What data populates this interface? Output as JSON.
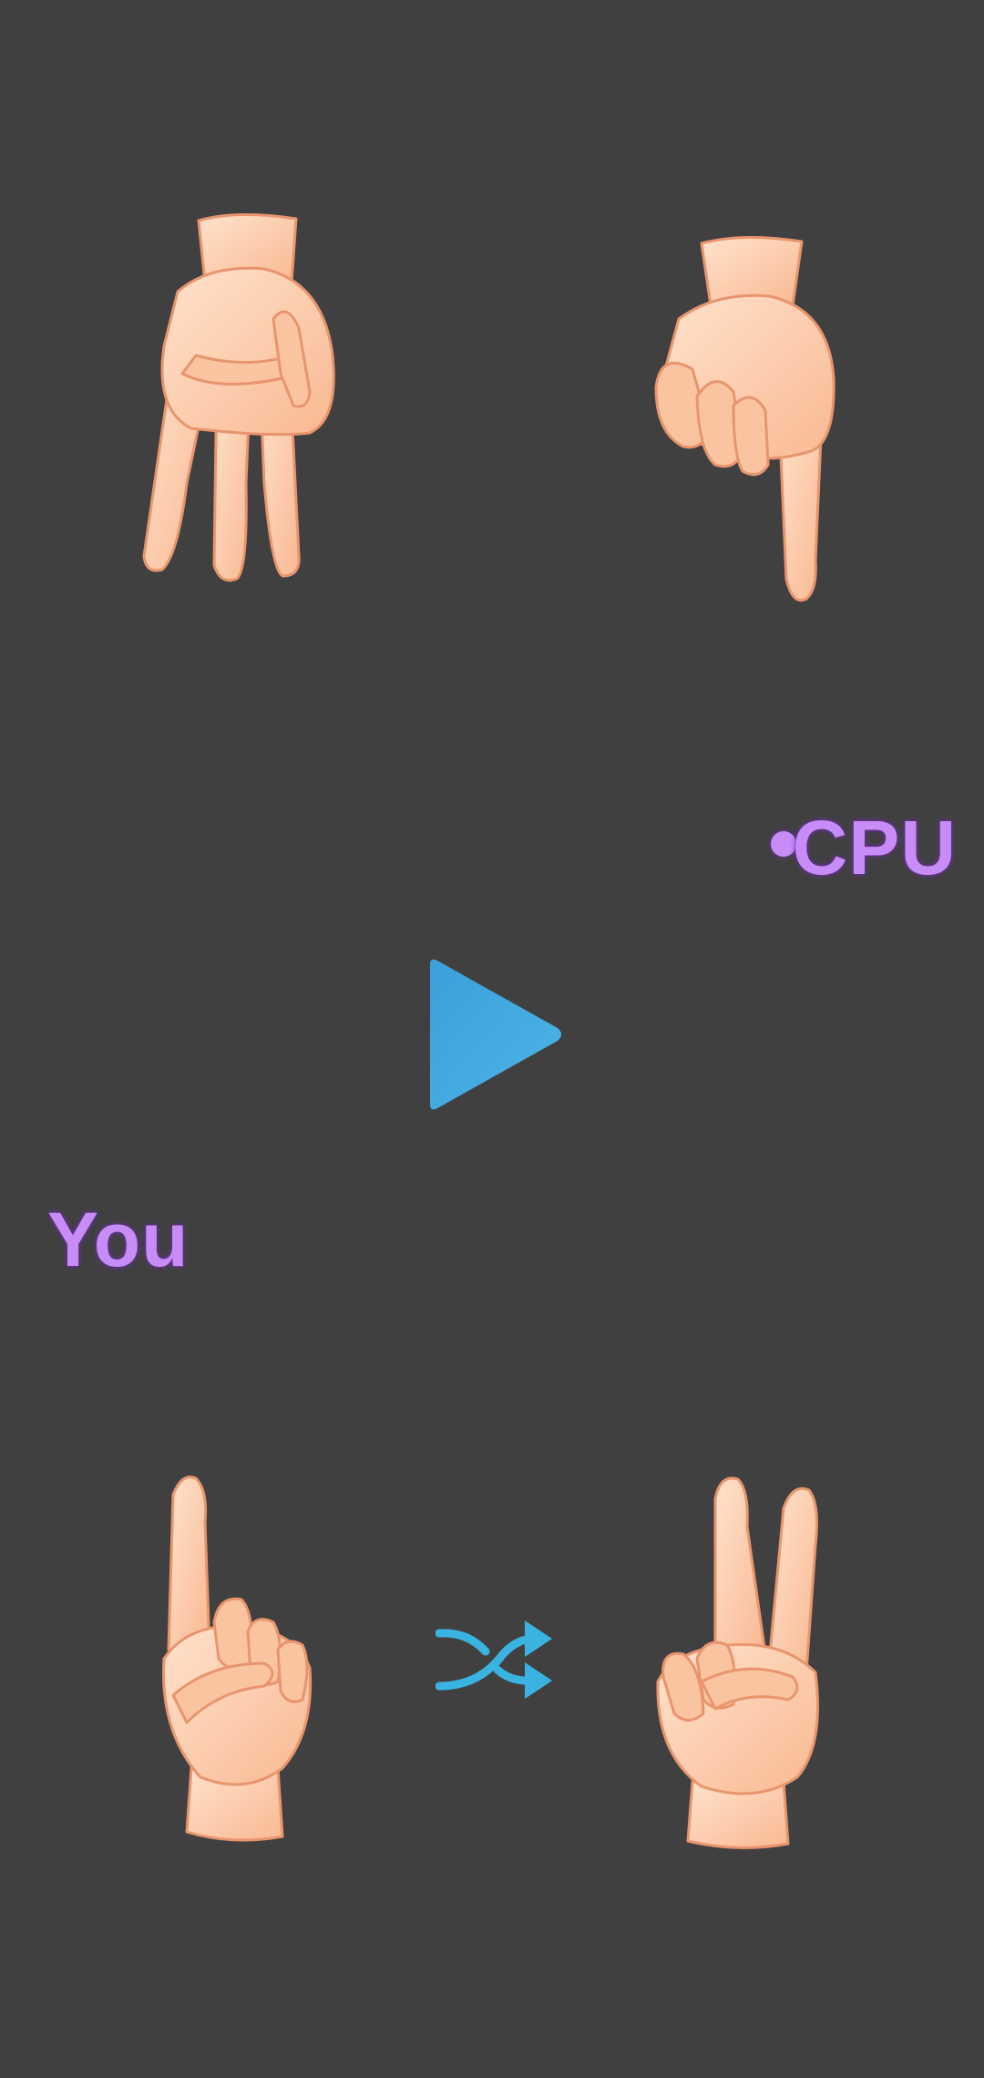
{
  "players": {
    "cpu": {
      "label": "CPU",
      "active_turn": true,
      "hands": [
        {
          "gesture": "three-fingers-down",
          "icon": "three-fingers-hand-icon"
        },
        {
          "gesture": "one-finger-down",
          "icon": "one-finger-hand-icon"
        }
      ]
    },
    "you": {
      "label": "You",
      "active_turn": false,
      "hands": [
        {
          "gesture": "one-finger-up",
          "icon": "one-finger-hand-icon"
        },
        {
          "gesture": "two-fingers-up",
          "icon": "two-fingers-hand-icon"
        }
      ]
    }
  },
  "controls": {
    "play_icon": "play-icon",
    "shuffle_icon": "shuffle-icon"
  },
  "colors": {
    "background": "#404040",
    "label": "#c78cf5",
    "play": "#3da6df",
    "shuffle": "#3ab3e0",
    "skin": "#fccba8",
    "skin_outline": "#e8956e"
  }
}
